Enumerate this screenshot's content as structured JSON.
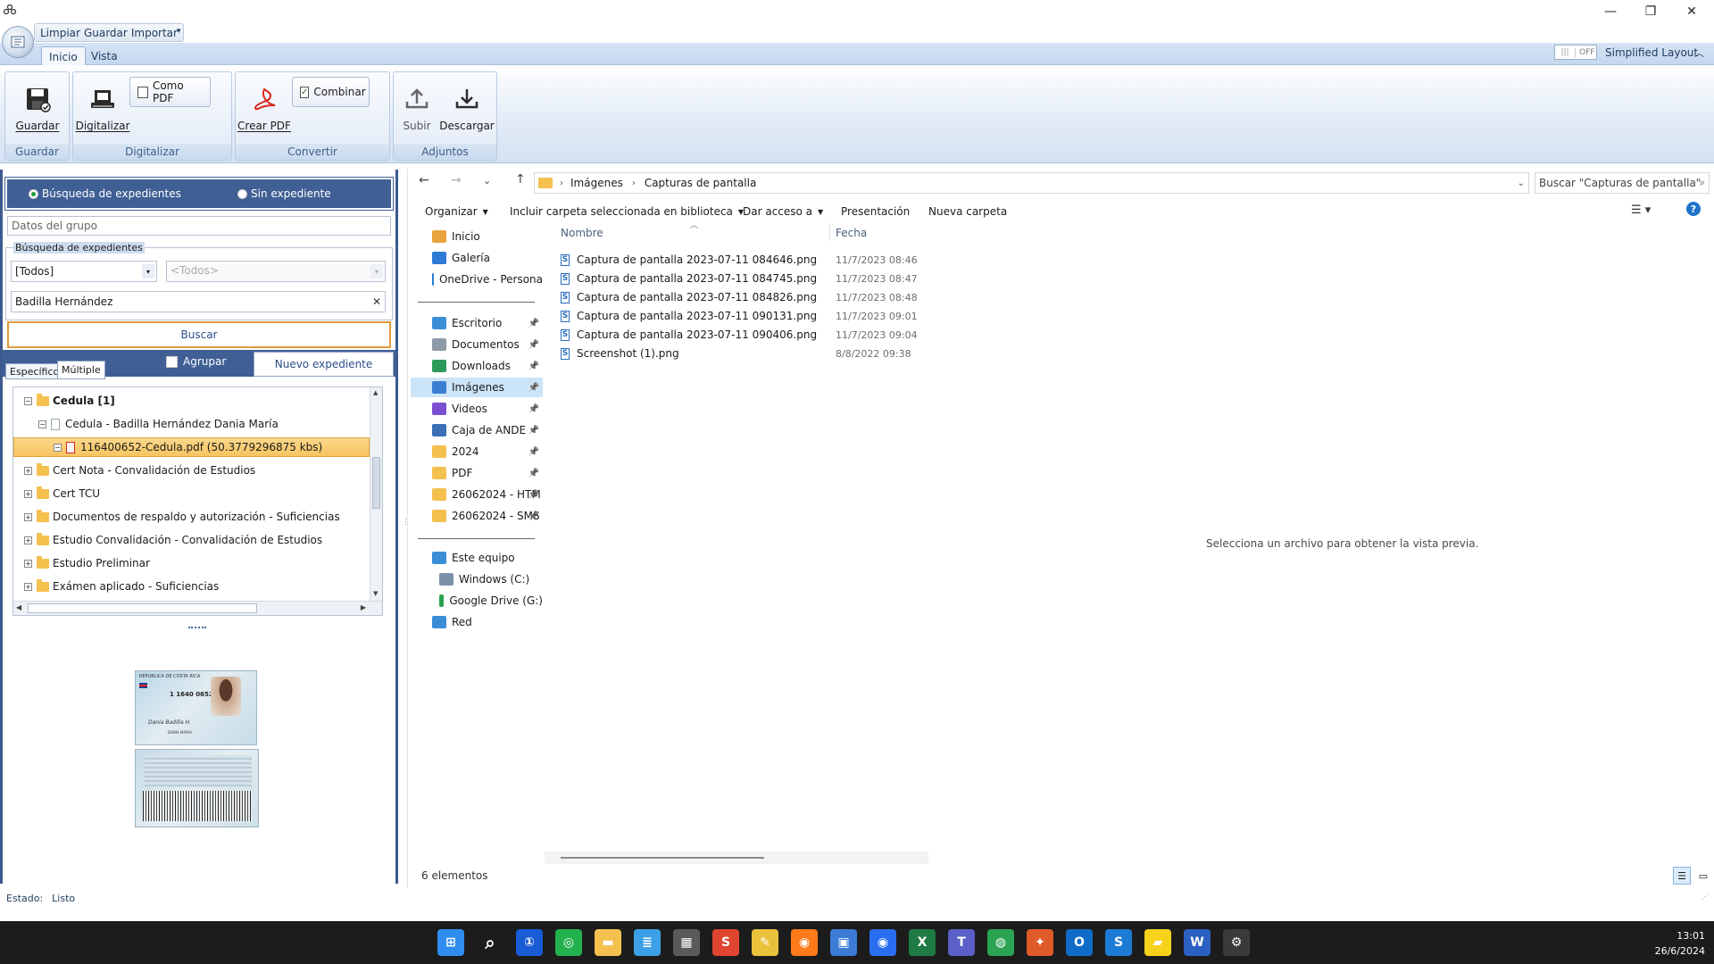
{
  "window": {
    "minimize": "—",
    "maximize": "❐",
    "close": "✕"
  },
  "quick_access": [
    "Limpiar",
    "Guardar",
    "Importar"
  ],
  "ribbon": {
    "tabs": [
      "Inicio",
      "Vista"
    ],
    "toggle_state": "OFF",
    "simplified_layout": "Simplified Layout",
    "groups": {
      "guardar": {
        "label": "Guardar",
        "button": "Guardar"
      },
      "digitalizar": {
        "label": "Digitalizar",
        "button": "Digitalizar",
        "check_label": "Como PDF",
        "checked": false
      },
      "convertir": {
        "label": "Convertir",
        "button": "Crear PDF",
        "check_label": "Combinar",
        "checked": true
      },
      "adjuntos": {
        "label": "Adjuntos",
        "upload": "Subir",
        "download": "Descargar"
      }
    }
  },
  "left": {
    "mode_options": [
      "Búsqueda de expedientes",
      "Sin expediente"
    ],
    "group_data_placeholder": "Datos del grupo",
    "search_section": "Búsqueda de expedientes",
    "filter1": "[Todos]",
    "filter2": "<Todos>",
    "search_text": "Badilla Hernández",
    "clear_icon": "✕",
    "search_button": "Buscar",
    "agrupar": "Agrupar",
    "new_button": "Nuevo expediente",
    "tabs": [
      "Específico",
      "Múltiple"
    ],
    "tree": [
      {
        "text": "Cedula [1]",
        "level": 0,
        "expander": "−",
        "type": "folder",
        "bold": true
      },
      {
        "text": "Cedula - Badilla Hernández Dania María",
        "level": 1,
        "expander": "−",
        "type": "doc"
      },
      {
        "text": "116400652-Cedula.pdf (50.3779296875 kbs)",
        "level": 2,
        "expander": "−",
        "type": "pdf",
        "selected": true
      },
      {
        "text": "Cert Nota - Convalidación de Estudios",
        "level": 0,
        "expander": "+",
        "type": "folder"
      },
      {
        "text": "Cert TCU",
        "level": 0,
        "expander": "+",
        "type": "folder"
      },
      {
        "text": "Documentos de respaldo y autorización - Suficiencias",
        "level": 0,
        "expander": "+",
        "type": "folder"
      },
      {
        "text": "Estudio Convalidación  - Convalidación de Estudios",
        "level": 0,
        "expander": "+",
        "type": "folder"
      },
      {
        "text": "Estudio Preliminar",
        "level": 0,
        "expander": "+",
        "type": "folder"
      },
      {
        "text": "Exámen aplicado - Suficiencias",
        "level": 0,
        "expander": "+",
        "type": "folder"
      }
    ],
    "id_card": {
      "header": "REPUBLICA DE COSTA RICA",
      "number": "1 1640 0652",
      "front_name": "DANIA MARIA",
      "signature": "Dania Badilla H."
    }
  },
  "explorer": {
    "breadcrumb": [
      "Imágenes",
      "Capturas de pantalla"
    ],
    "search_placeholder": "Buscar  \"Capturas de pantalla\"",
    "commands": [
      "Organizar",
      "Incluir carpeta seleccionada en biblioteca",
      "Dar acceso a",
      "Presentación",
      "Nueva carpeta"
    ],
    "columns": {
      "name": "Nombre",
      "date": "Fecha"
    },
    "nav_top": [
      {
        "label": "Inicio",
        "color": "#e8a33c"
      },
      {
        "label": "Galería",
        "color": "#2f7ad6"
      },
      {
        "label": "OneDrive - Persona",
        "color": "#2b7cd3"
      }
    ],
    "nav_quick": [
      {
        "label": "Escritorio",
        "color": "#3a8ed8",
        "pinned": true
      },
      {
        "label": "Documentos",
        "color": "#8f9aa8",
        "pinned": true
      },
      {
        "label": "Downloads",
        "color": "#2c9b5a",
        "pinned": true
      },
      {
        "label": "Imágenes",
        "color": "#3b7fd4",
        "pinned": true,
        "selected": true
      },
      {
        "label": "Videos",
        "color": "#7b4fd1",
        "pinned": true
      },
      {
        "label": "Caja de ANDE",
        "color": "#3b6fb6",
        "pinned": true
      },
      {
        "label": "2024",
        "color": "#f4c04e",
        "pinned": true
      },
      {
        "label": "PDF",
        "color": "#f4c04e",
        "pinned": true
      },
      {
        "label": "26062024 - HTM",
        "color": "#f4c04e",
        "pinned": true
      },
      {
        "label": "26062024 - SMS",
        "color": "#f4c04e",
        "pinned": true
      }
    ],
    "nav_pc": [
      {
        "label": "Este equipo",
        "color": "#3a8ed8",
        "indent": 0
      },
      {
        "label": "Windows (C:)",
        "color": "#7a8fa8",
        "indent": 1
      },
      {
        "label": "Google Drive (G:)",
        "color": "#2ca24f",
        "indent": 1
      },
      {
        "label": "Red",
        "color": "#3a8ed8",
        "indent": 0
      }
    ],
    "files": [
      {
        "name": "Captura de pantalla 2023-07-11 084646.png",
        "date": "11/7/2023 08:46"
      },
      {
        "name": "Captura de pantalla 2023-07-11 084745.png",
        "date": "11/7/2023 08:47"
      },
      {
        "name": "Captura de pantalla 2023-07-11 084826.png",
        "date": "11/7/2023 08:48"
      },
      {
        "name": "Captura de pantalla 2023-07-11 090131.png",
        "date": "11/7/2023 09:01"
      },
      {
        "name": "Captura de pantalla 2023-07-11 090406.png",
        "date": "11/7/2023 09:04"
      },
      {
        "name": "Screenshot (1).png",
        "date": "8/8/2022 09:38"
      }
    ],
    "preview_text": "Selecciona un archivo para obtener la vista previa.",
    "count": "6 elementos"
  },
  "status": {
    "label": "Estado:",
    "value": "Listo"
  },
  "taskbar": {
    "time": "13:01",
    "date": "26/6/2024",
    "apps": [
      {
        "name": "start",
        "color": "#2f8df0",
        "glyph": "⊞"
      },
      {
        "name": "search",
        "color": "transparent",
        "glyph": "⌕"
      },
      {
        "name": "1password",
        "color": "#1a5bd6",
        "glyph": "①"
      },
      {
        "name": "whatsapp",
        "color": "#22b14c",
        "glyph": "◎"
      },
      {
        "name": "file-explorer",
        "color": "#f4c04e",
        "glyph": "▬"
      },
      {
        "name": "notepad",
        "color": "#3ca0e6",
        "glyph": "≣"
      },
      {
        "name": "calculator",
        "color": "#5a5a5a",
        "glyph": "▦"
      },
      {
        "name": "app-s-red",
        "color": "#e0452f",
        "glyph": "S"
      },
      {
        "name": "app-yellow-tools",
        "color": "#e9c13a",
        "glyph": "✎"
      },
      {
        "name": "firefox",
        "color": "#ff7a1a",
        "glyph": "◉"
      },
      {
        "name": "remote-desktop",
        "color": "#3c7bd6",
        "glyph": "▣"
      },
      {
        "name": "firefox-dev",
        "color": "#2a6ef0",
        "glyph": "◉"
      },
      {
        "name": "excel",
        "color": "#1f7a44",
        "glyph": "X"
      },
      {
        "name": "teams",
        "color": "#5b5fc7",
        "glyph": "T"
      },
      {
        "name": "chrome",
        "color": "#2aa352",
        "glyph": "◍"
      },
      {
        "name": "app-orange",
        "color": "#e05a2a",
        "glyph": "✦"
      },
      {
        "name": "outlook",
        "color": "#0f6cc6",
        "glyph": "O"
      },
      {
        "name": "app-s-blue",
        "color": "#1c7cd5",
        "glyph": "S"
      },
      {
        "name": "sticky-notes",
        "color": "#f6d21a",
        "glyph": "▰"
      },
      {
        "name": "word",
        "color": "#2b5fc1",
        "glyph": "W"
      },
      {
        "name": "current-app",
        "color": "#3a3a3a",
        "glyph": "⚙"
      }
    ]
  }
}
